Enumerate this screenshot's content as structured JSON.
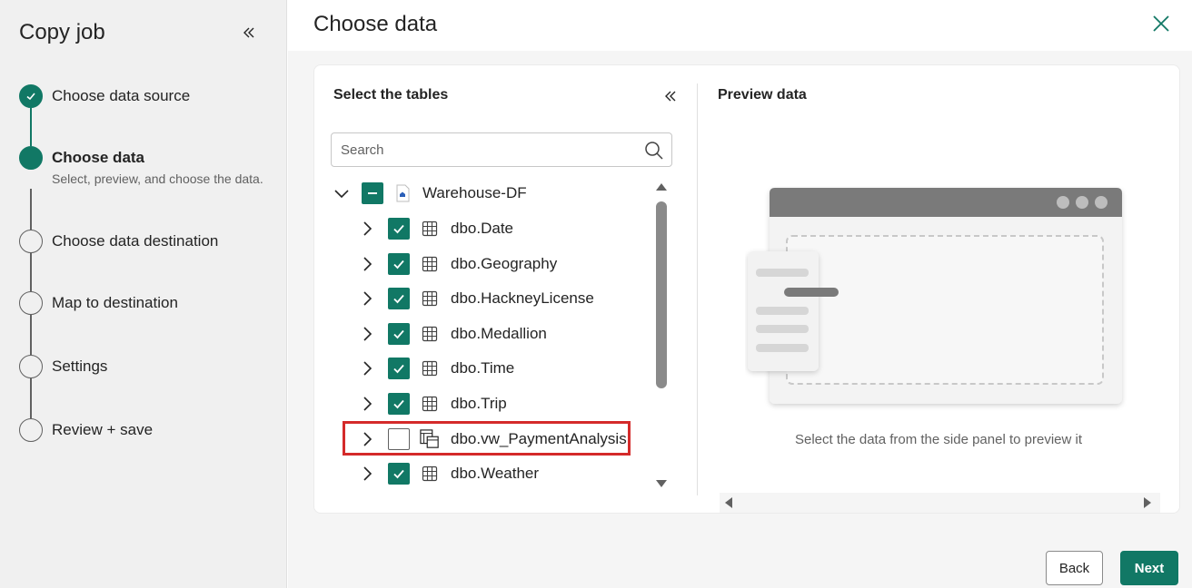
{
  "wizard": {
    "title": "Copy job",
    "steps": [
      {
        "label": "Choose data source",
        "state": "done"
      },
      {
        "label": "Choose data",
        "state": "current",
        "sub": "Select, preview, and choose the data."
      },
      {
        "label": "Choose data destination",
        "state": "pending"
      },
      {
        "label": "Map to destination",
        "state": "pending"
      },
      {
        "label": "Settings",
        "state": "pending"
      },
      {
        "label": "Review + save",
        "state": "pending"
      }
    ]
  },
  "main": {
    "title": "Choose data",
    "tables_panel": {
      "heading": "Select the tables",
      "search_placeholder": "Search",
      "root": {
        "label": "Warehouse-DF",
        "state": "indeterminate"
      },
      "items": [
        {
          "label": "dbo.Date",
          "checked": true,
          "kind": "table"
        },
        {
          "label": "dbo.Geography",
          "checked": true,
          "kind": "table"
        },
        {
          "label": "dbo.HackneyLicense",
          "checked": true,
          "kind": "table"
        },
        {
          "label": "dbo.Medallion",
          "checked": true,
          "kind": "table"
        },
        {
          "label": "dbo.Time",
          "checked": true,
          "kind": "table"
        },
        {
          "label": "dbo.Trip",
          "checked": true,
          "kind": "table"
        },
        {
          "label": "dbo.vw_PaymentAnalysis",
          "checked": false,
          "kind": "view"
        },
        {
          "label": "dbo.Weather",
          "checked": true,
          "kind": "table"
        }
      ]
    },
    "preview_panel": {
      "heading": "Preview data",
      "empty_message": "Select the data from the side panel to preview it"
    }
  },
  "footer": {
    "back_label": "Back",
    "next_label": "Next"
  },
  "colors": {
    "accent": "#117865",
    "highlight": "#d42a2a"
  }
}
